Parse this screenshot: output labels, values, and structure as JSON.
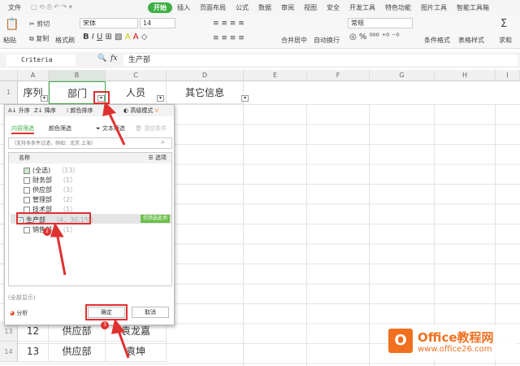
{
  "menu": {
    "file": "文件",
    "tabs": [
      "开始",
      "插入",
      "页面布局",
      "公式",
      "数据",
      "审阅",
      "视图",
      "安全",
      "开发工具",
      "特色功能",
      "图片工具",
      "智能工具箱"
    ],
    "active": 0
  },
  "ribbon": {
    "paste": "粘贴",
    "cut": "剪切",
    "copy": "复制",
    "format_painter": "格式刷",
    "font": "宋体",
    "size": "14",
    "merge": "合并居中",
    "wrap": "自动换行",
    "number_format": "常规",
    "cond_format": "条件格式",
    "table_style": "表格样式",
    "sum": "求和"
  },
  "formula_bar": {
    "name_box": "Criteria",
    "fx": "fx",
    "value": "生产部"
  },
  "columns": [
    "A",
    "B",
    "C",
    "D",
    "E",
    "F",
    "G",
    "H",
    "I"
  ],
  "header_row": {
    "num": "1",
    "cells": [
      "序列",
      "部门",
      "人员",
      "其它信息"
    ]
  },
  "rows": [
    {
      "num": "13",
      "cells": [
        "12",
        "供应部",
        "袁龙嘉"
      ]
    },
    {
      "num": "14",
      "cells": [
        "13",
        "供应部",
        "袁坤"
      ]
    }
  ],
  "filter": {
    "sort_asc": "升序",
    "sort_desc": "降序",
    "color_sort": "颜色排序",
    "advanced": "高级模式",
    "tab_content": "内容筛选",
    "tab_color": "颜色筛选",
    "text_filter": "文本筛选",
    "clear": "清空条件",
    "search_placeholder": "（支持多条件过滤，例如：北京 上海）",
    "list_header": "名称",
    "options": "选项",
    "items": [
      {
        "label": "(全选)",
        "count": "（13）",
        "checked": "partial"
      },
      {
        "label": "财务部",
        "count": "（1）",
        "checked": false
      },
      {
        "label": "供应部",
        "count": "（3）",
        "checked": false
      },
      {
        "label": "管理部",
        "count": "（2）",
        "checked": false
      },
      {
        "label": "技术部",
        "count": "（1）",
        "checked": false
      },
      {
        "label": "生产部",
        "count": "（4，30.1%）",
        "checked": true
      },
      {
        "label": "销售部",
        "count": "（1）",
        "checked": false
      }
    ],
    "only_this": "仅筛选此项",
    "show_all": "(全部显示)",
    "analysis": "分析",
    "ok": "确定",
    "cancel": "取消"
  },
  "annotations": [
    "1",
    "2",
    "3"
  ],
  "watermark": {
    "brand": "Office教程网",
    "url": "www.office26.com"
  },
  "colors": {
    "accent": "#3fae45",
    "annotation": "#e03030",
    "watermark": "#f07020"
  }
}
